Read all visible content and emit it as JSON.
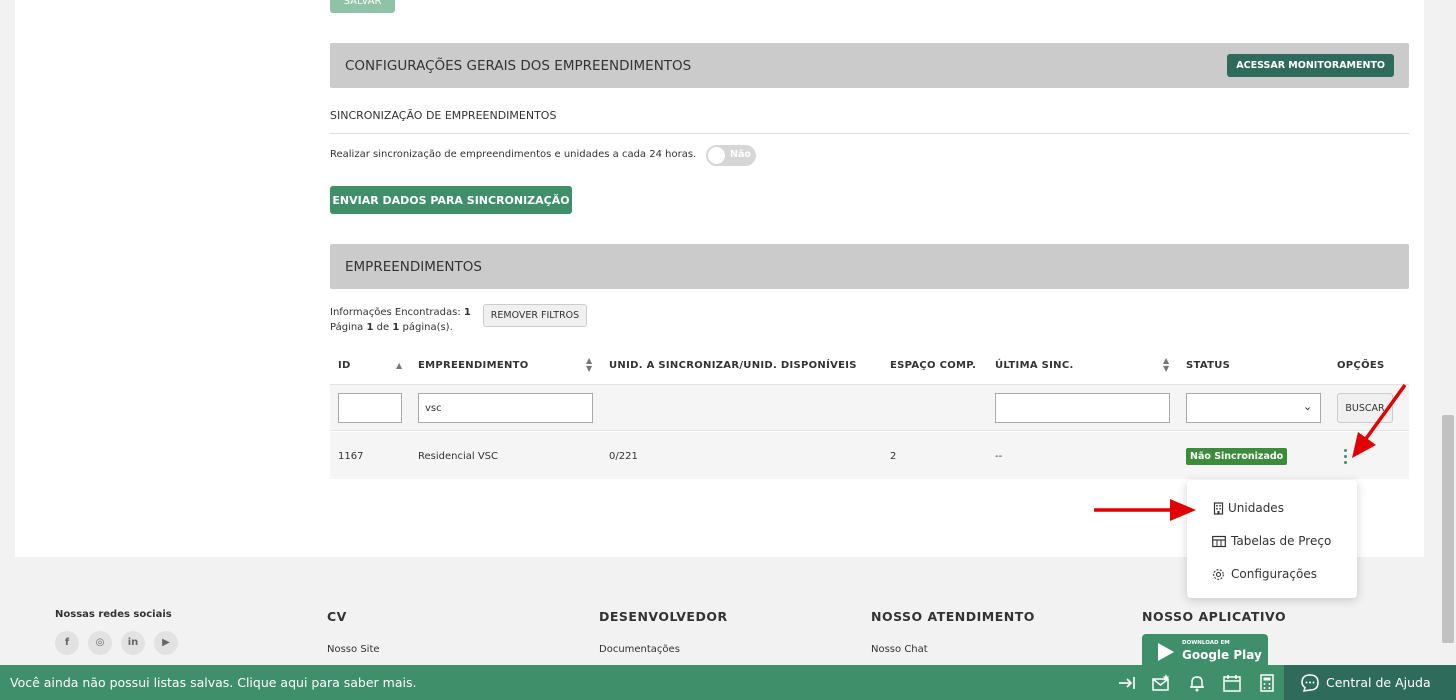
{
  "top": {
    "save_label": "SALVAR"
  },
  "settings_section": {
    "title": "CONFIGURAÇÕES GERAIS DOS EMPREENDIMENTOS",
    "monitor_button": "ACESSAR MONITORAMENTO",
    "sync_title": "SINCRONIZAÇÃO DE EMPREENDIMENTOS",
    "sync_text": "Realizar sincronização de empreendimentos e unidades a cada 24 horas.",
    "toggle_label": "Não",
    "send_button": "ENVIAR DADOS PARA SINCRONIZAÇÃO"
  },
  "list_section": {
    "title": "EMPREENDIMENTOS",
    "info_found_label": "Informações Encontradas:",
    "info_found_count": "1",
    "page_prefix": "Página",
    "page_current": "1",
    "page_of": "de",
    "page_total": "1",
    "page_suffix": "página(s).",
    "remove_filters": "REMOVER FILTROS"
  },
  "table": {
    "headers": {
      "id": "ID",
      "empreendimento": "EMPREENDIMENTO",
      "unidades": "UNID. A SINCRONIZAR/UNID. DISPONÍVEIS",
      "espaco": "ESPAÇO COMP.",
      "ultima": "ÚLTIMA SINC.",
      "status": "STATUS",
      "opcoes": "OPÇÕES"
    },
    "filters": {
      "id_value": "",
      "empreendimento_value": "vsc",
      "ultima_value": "",
      "status_value": "",
      "search_button": "BUSCAR"
    },
    "rows": [
      {
        "id": "1167",
        "empreendimento": "Residencial VSC",
        "unidades": "0/221",
        "espaco": "2",
        "ultima": "--",
        "status": "Não Sincronizado",
        "status_color": "#3c8c3c"
      }
    ]
  },
  "options_menu": {
    "items": [
      {
        "label": "Unidades",
        "icon": "building-icon"
      },
      {
        "label": "Tabelas de Preço",
        "icon": "table-icon"
      },
      {
        "label": "Configurações",
        "icon": "gear-icon"
      }
    ]
  },
  "footer": {
    "social_title": "Nossas redes sociais",
    "social_icons": [
      "facebook-icon",
      "instagram-icon",
      "linkedin-icon",
      "youtube-icon"
    ],
    "columns": [
      {
        "title": "CV",
        "link": "Nosso Site"
      },
      {
        "title": "DESENVOLVEDOR",
        "link": "Documentações"
      },
      {
        "title": "NOSSO ATENDIMENTO",
        "link": "Nosso Chat"
      },
      {
        "title": "NOSSO APLICATIVO",
        "link": ""
      }
    ],
    "gplay_small": "DOWNLOAD EM",
    "gplay_big": "Google Play"
  },
  "bottom_bar": {
    "message": "Você ainda não possui listas salvas. Clique aqui para saber mais.",
    "help_label": "Central de Ajuda",
    "icons": [
      "collapse-icon",
      "mail-star-icon",
      "bell-icon",
      "calendar-icon",
      "calculator-icon",
      "chat-icon"
    ]
  },
  "colors": {
    "primary_green": "#3f8f6a",
    "dark_green": "#2f6b5a",
    "section_gray": "#cbcbcb",
    "annotation_red": "#e00000"
  }
}
